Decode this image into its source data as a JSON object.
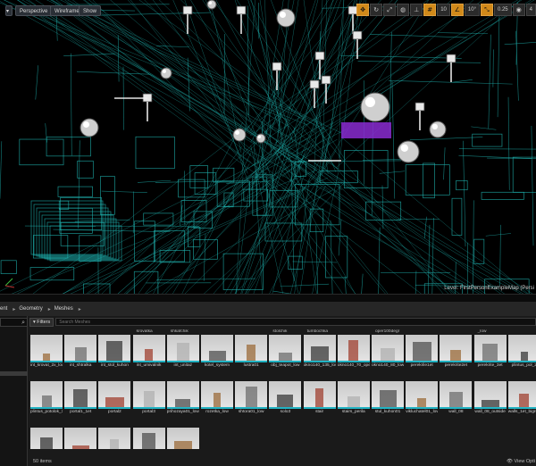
{
  "viewport": {
    "perspective_label": "Perspective",
    "wireframe_label": "Wireframe",
    "show_label": "Show",
    "toolbar": {
      "grid_value": "10",
      "rotate_value": "10°",
      "scale_value": "0.25",
      "camera_value": "4"
    },
    "level_prefix": "Level:",
    "level_name": "FirstPersonExampleMap (Persi"
  },
  "content_browser": {
    "path": [
      "ent",
      "Geometry",
      "Meshes"
    ],
    "filters_label": "▾ Filters",
    "search_placeholder": "Search Meshes",
    "row0_labels": [
      "krovatka",
      "shkafchik",
      "stolchik",
      "tumbochka",
      "oper100degr",
      "_low"
    ],
    "rows": [
      [
        "int_krovat_2x_low",
        "int_shtralka",
        "int_stol_kuhon",
        "int_umivalnik",
        "int_unitaz",
        "kotel_system",
        "lustra01",
        "obj_teapot_low",
        "okno140_135_low",
        "okno140_70_opening_low",
        "okno140_80_low",
        "perekrile1et",
        "perekrite2et",
        "perekrite_3et",
        "plintus_pol_2"
      ],
      [
        "plintus_potolok_1_et",
        "portal1_1et",
        "portal2",
        "portal3",
        "prihozaya01_low",
        "rozetka_low",
        "shtora01_low",
        "solo3",
        "stair",
        "stairs_perila",
        "stul_kuhon01",
        "vikluchatel01_low",
        "wall_08",
        "wall_08_outside",
        "walls_1et_bigroom"
      ],
      [
        "",
        "",
        "",
        "",
        ""
      ]
    ],
    "items_count": "50 items",
    "view_options": "👁 View Opti"
  },
  "colors": {
    "wire": "#1fb5b2",
    "accent": "#d18a1a",
    "cyan_bar": "#22b3c3"
  }
}
